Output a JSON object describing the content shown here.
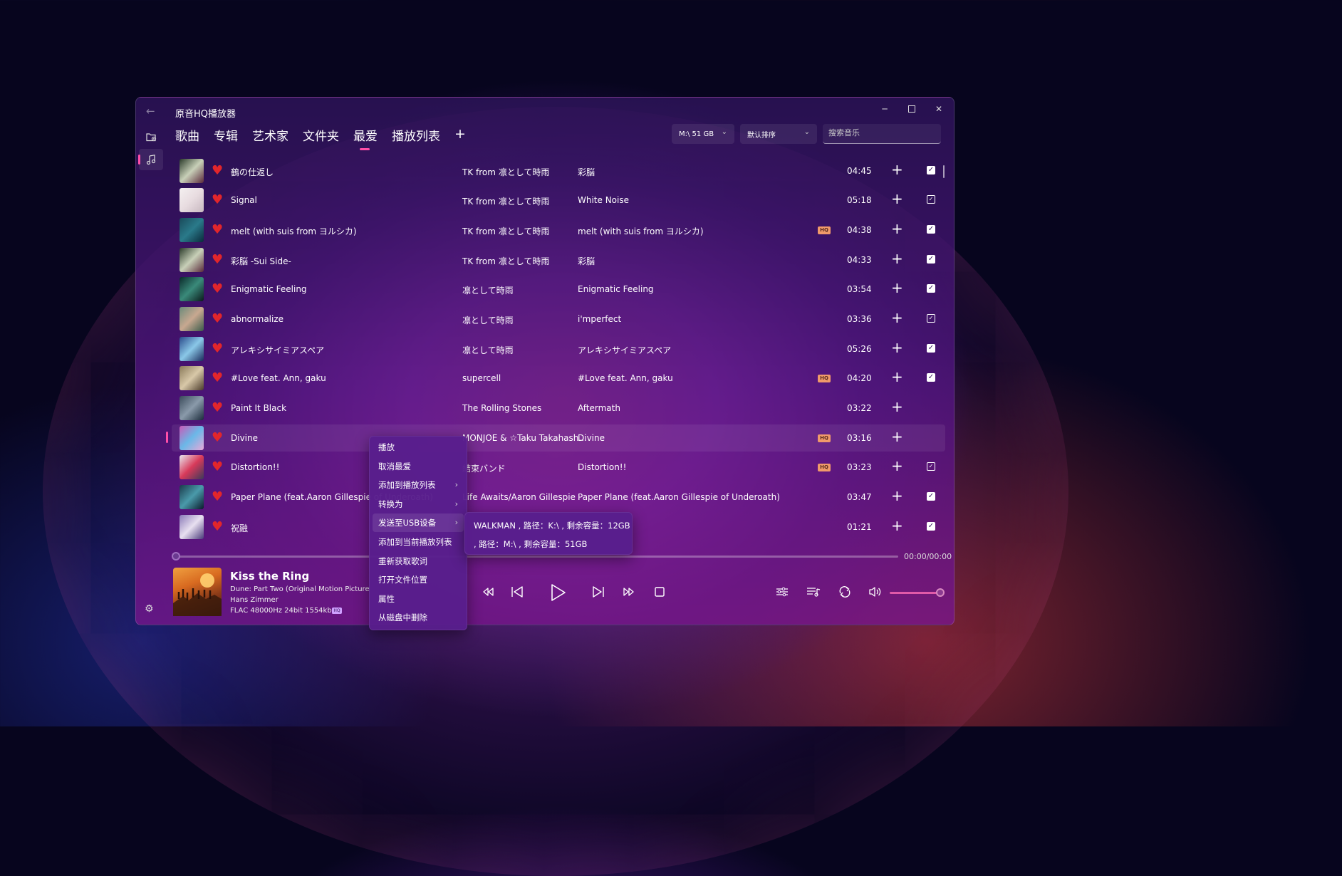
{
  "app": {
    "title": "原音HQ播放器"
  },
  "tabs": [
    {
      "label": "歌曲",
      "active": false
    },
    {
      "label": "专辑",
      "active": false
    },
    {
      "label": "艺术家",
      "active": false
    },
    {
      "label": "文件夹",
      "active": false
    },
    {
      "label": "最爱",
      "active": true
    },
    {
      "label": "播放列表",
      "active": false
    }
  ],
  "toolbar": {
    "add_tab": "+",
    "device_select": "M:\\ 51 GB",
    "sort_select": "默认排序",
    "search_placeholder": "搜索音乐"
  },
  "songs": [
    {
      "title": "鶴の仕返し",
      "artist": "TK from 凛として時雨",
      "album": "彩脳",
      "hq": false,
      "duration": "04:45",
      "checked": "filled",
      "art": [
        "#2a3a2a",
        "#c8d0b8",
        "#5a2a3a"
      ]
    },
    {
      "title": "Signal",
      "artist": "TK from 凛として時雨",
      "album": "White Noise",
      "hq": false,
      "duration": "05:18",
      "checked": "outline",
      "art": [
        "#f4f0f0",
        "#e8dce0",
        "#c8b8c0"
      ]
    },
    {
      "title": "melt (with suis from ヨルシカ)",
      "artist": "TK from 凛として時雨",
      "album": "melt (with suis from ヨルシカ)",
      "hq": true,
      "duration": "04:38",
      "checked": "filled",
      "art": [
        "#1a4a5a",
        "#2a7a8a",
        "#0a2a3a"
      ]
    },
    {
      "title": "彩脳 -Sui Side-",
      "artist": "TK from 凛として時雨",
      "album": "彩脳",
      "hq": false,
      "duration": "04:33",
      "checked": "filled",
      "art": [
        "#2a3a2a",
        "#c8d0b8",
        "#5a2a3a"
      ]
    },
    {
      "title": "Enigmatic Feeling",
      "artist": "凛として時雨",
      "album": "Enigmatic Feeling",
      "hq": false,
      "duration": "03:54",
      "checked": "filled",
      "art": [
        "#0a2a2a",
        "#3a8a7a",
        "#0a1a1a"
      ]
    },
    {
      "title": "abnormalize",
      "artist": "凛として時雨",
      "album": "i'mperfect",
      "hq": false,
      "duration": "03:36",
      "checked": "outline",
      "art": [
        "#6a8a7a",
        "#c8a890",
        "#3a5a4a"
      ]
    },
    {
      "title": "アレキシサイミアスペア",
      "artist": "凛として時雨",
      "album": "アレキシサイミアスペア",
      "hq": false,
      "duration": "05:26",
      "checked": "filled",
      "art": [
        "#2a4a8a",
        "#8ac8e8",
        "#1a2a5a"
      ]
    },
    {
      "title": "#Love feat. Ann, gaku",
      "artist": "supercell",
      "album": "#Love feat. Ann, gaku",
      "hq": true,
      "duration": "04:20",
      "checked": "filled",
      "art": [
        "#8a7a5a",
        "#d8c8a8",
        "#4a3a2a"
      ]
    },
    {
      "title": "Paint It Black",
      "artist": "The Rolling Stones",
      "album": "Aftermath",
      "hq": false,
      "duration": "03:22",
      "checked": "none",
      "art": [
        "#3a4a5a",
        "#8a9aaa",
        "#1a2a3a"
      ]
    },
    {
      "title": "Divine",
      "artist": "MONJOE & ☆Taku Takahash...",
      "album": "Divine",
      "hq": true,
      "duration": "03:16",
      "checked": "none",
      "art": [
        "#c85ab8",
        "#6ab8e8",
        "#e8a8d8"
      ]
    },
    {
      "title": "Distortion!!",
      "artist": "結束バンド",
      "album": "Distortion!!",
      "hq": true,
      "duration": "03:23",
      "checked": "outline",
      "art": [
        "#e8e8f0",
        "#d83a5a",
        "#3a3a5a"
      ]
    },
    {
      "title": "Paper Plane (feat.Aaron Gillespie of Underoath)",
      "artist": "Life Awaits/Aaron Gillespie",
      "album": "Paper Plane (feat.Aaron Gillespie of Underoath)",
      "hq": false,
      "duration": "03:47",
      "checked": "filled",
      "art": [
        "#1a3a4a",
        "#4a9aaa",
        "#0a1a2a"
      ]
    },
    {
      "title": "祝融",
      "artist": "",
      "album": "",
      "hq": false,
      "duration": "01:21",
      "checked": "filled",
      "art": [
        "#8a7ab8",
        "#e8e0f0",
        "#4a3a7a"
      ]
    }
  ],
  "playback": {
    "time": "00:00/00:00",
    "progress_fraction": 0,
    "volume_fraction": 0.98,
    "now_playing": {
      "title": "Kiss the Ring",
      "album": "Dune: Part Two (Original Motion Picture Soundtrack)",
      "artist": "Hans Zimmer",
      "format": "FLAC 48000Hz 24bit 1554kbps",
      "hq_badge": "HQ"
    }
  },
  "context_menu": {
    "items": [
      {
        "label": "播放",
        "submenu": false
      },
      {
        "label": "取消最爱",
        "submenu": false
      },
      {
        "label": "添加到播放列表",
        "submenu": true
      },
      {
        "label": "转换为",
        "submenu": true
      },
      {
        "label": "发送至USB设备",
        "submenu": true,
        "active": true
      },
      {
        "label": "添加到当前播放列表",
        "submenu": false
      },
      {
        "label": "重新获取歌词",
        "submenu": false
      },
      {
        "label": "打开文件位置",
        "submenu": false
      },
      {
        "label": "属性",
        "submenu": false
      },
      {
        "label": "从磁盘中删除",
        "submenu": false
      }
    ],
    "usb_devices": [
      {
        "label": "WALKMAN , 路径：K:\\ , 剩余容量：12GB"
      },
      {
        "label": " , 路径：M:\\ , 剩余容量：51GB"
      }
    ]
  },
  "colors": {
    "accent": "#ff4fa8",
    "heart": "#e2262b",
    "hq_badge": "#f09a6a"
  },
  "icons": {
    "back": "arrow-left-icon",
    "add_folder": "folder-add-icon",
    "music": "music-note-icon",
    "settings": "gear-icon",
    "heart": "heart-icon",
    "add": "plus-icon",
    "check": "checkbox-icon"
  }
}
